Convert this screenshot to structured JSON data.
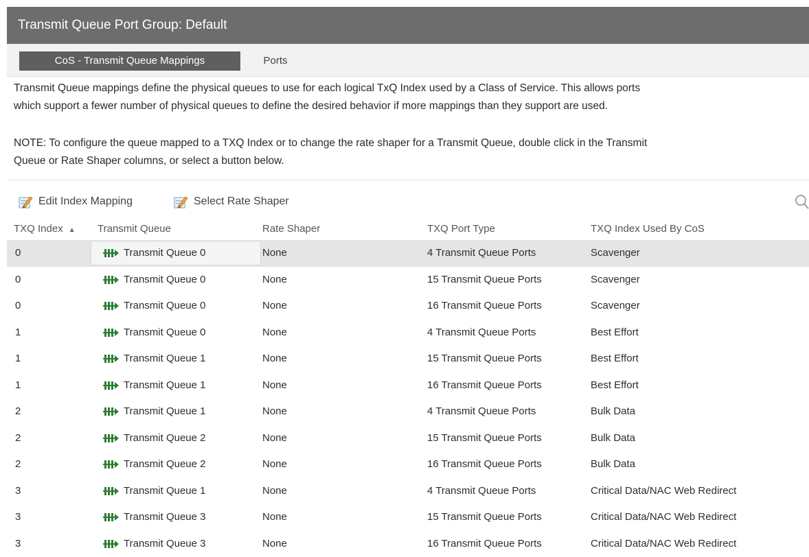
{
  "window": {
    "title": "Transmit Queue Port Group: Default"
  },
  "tabs": [
    {
      "label": "CoS - Transmit Queue Mappings",
      "active": true
    },
    {
      "label": "Ports",
      "active": false
    }
  ],
  "description": {
    "line1": "Transmit Queue mappings define the physical queues to use for each logical TxQ Index used by a Class of Service. This allows ports",
    "line2": "which support a fewer number of physical queues to define the desired behavior if more mappings than they support are used.",
    "note1": "NOTE: To configure the queue mapped to a TXQ Index or to change the rate shaper for a Transmit Queue, double click in the Transmit",
    "note2": "Queue or Rate Shaper columns, or select a button below."
  },
  "toolbar": {
    "edit_label": "Edit Index Mapping",
    "edit_icon": "edit-pencil-icon",
    "rate_label": "Select Rate Shaper",
    "rate_icon": "edit-pencil-icon",
    "search_icon": "search-icon"
  },
  "table": {
    "headers": [
      "TXQ Index",
      "Transmit Queue",
      "Rate Shaper",
      "TXQ Port Type",
      "TXQ Index Used By CoS"
    ],
    "sorted_column": "TXQ Index",
    "sort_direction": "ascending",
    "rows": [
      [
        "0",
        "Transmit Queue 0",
        "None",
        "4 Transmit Queue Ports",
        "Scavenger"
      ],
      [
        "0",
        "Transmit Queue 0",
        "None",
        "15 Transmit Queue Ports",
        "Scavenger"
      ],
      [
        "0",
        "Transmit Queue 0",
        "None",
        "16 Transmit Queue Ports",
        "Scavenger"
      ],
      [
        "1",
        "Transmit Queue 0",
        "None",
        "4 Transmit Queue Ports",
        "Best Effort"
      ],
      [
        "1",
        "Transmit Queue 1",
        "None",
        "15 Transmit Queue Ports",
        "Best Effort"
      ],
      [
        "1",
        "Transmit Queue 1",
        "None",
        "16 Transmit Queue Ports",
        "Best Effort"
      ],
      [
        "2",
        "Transmit Queue 1",
        "None",
        "4 Transmit Queue Ports",
        "Bulk Data"
      ],
      [
        "2",
        "Transmit Queue 2",
        "None",
        "15 Transmit Queue Ports",
        "Bulk Data"
      ],
      [
        "2",
        "Transmit Queue 2",
        "None",
        "16 Transmit Queue Ports",
        "Bulk Data"
      ],
      [
        "3",
        "Transmit Queue 1",
        "None",
        "4 Transmit Queue Ports",
        "Critical Data/NAC Web Redirect"
      ],
      [
        "3",
        "Transmit Queue 3",
        "None",
        "15 Transmit Queue Ports",
        "Critical Data/NAC Web Redirect"
      ],
      [
        "3",
        "Transmit Queue 3",
        "None",
        "16 Transmit Queue Ports",
        "Critical Data/NAC Web Redirect"
      ]
    ],
    "selected_row": 0,
    "queue_icon": "transmit-queue-icon"
  },
  "colors": {
    "titlebar_bg": "#6d6d6d",
    "active_tab_bg": "#5f5f5f",
    "selected_row_bg": "#e5e5e5",
    "queue_icon": "#2e7d32"
  }
}
